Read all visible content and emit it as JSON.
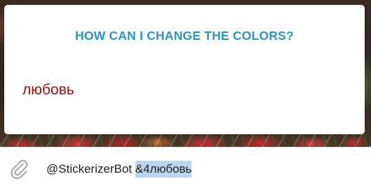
{
  "sticker_preview": {
    "title": "HOW CAN I CHANGE THE COLORS?",
    "sample_text": "любовь"
  },
  "composer": {
    "attach_icon": "paperclip-icon",
    "input_value_plain": "@StickerizerBot ",
    "input_value_selected": "&4любовь"
  },
  "colors": {
    "title": "#2a94cc",
    "sample_text": "#a01212",
    "selection": "#b8d6f0"
  }
}
